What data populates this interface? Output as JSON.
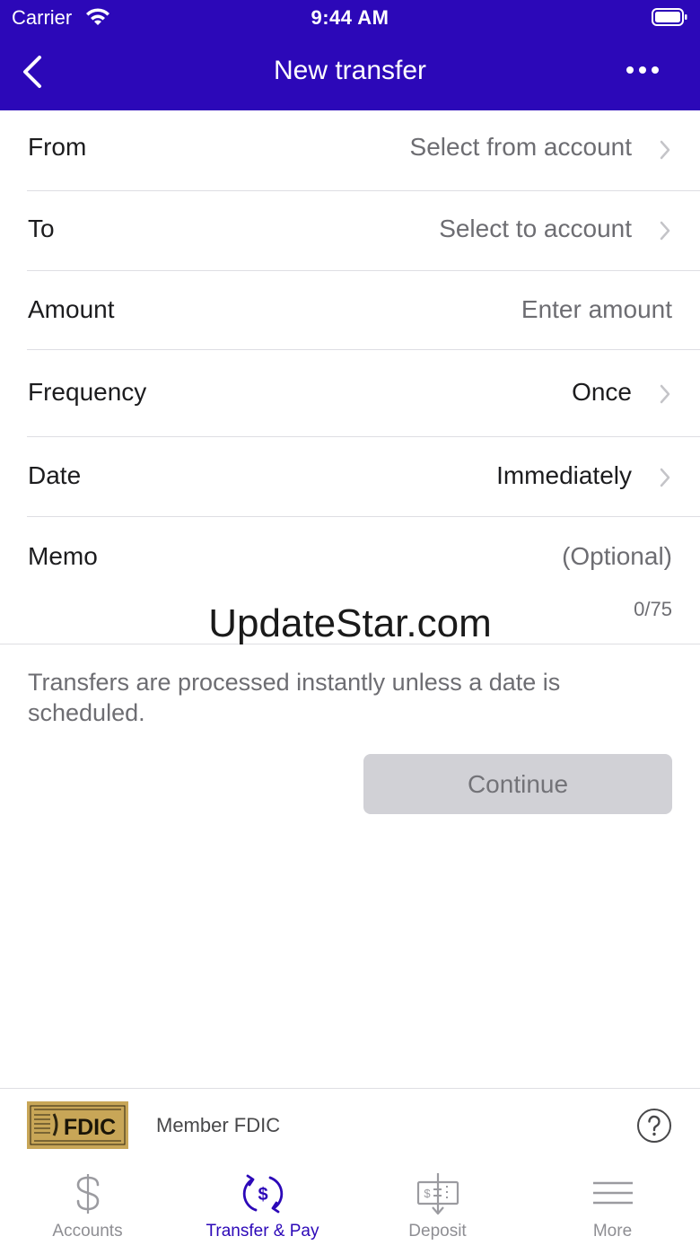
{
  "status_bar": {
    "carrier": "Carrier",
    "time": "9:44 AM"
  },
  "nav": {
    "title": "New transfer"
  },
  "form": {
    "from": {
      "label": "From",
      "placeholder": "Select from account"
    },
    "to": {
      "label": "To",
      "placeholder": "Select to account"
    },
    "amount": {
      "label": "Amount",
      "placeholder": "Enter amount"
    },
    "frequency": {
      "label": "Frequency",
      "value": "Once"
    },
    "date": {
      "label": "Date",
      "value": "Immediately"
    },
    "memo": {
      "label": "Memo",
      "placeholder": "(Optional)",
      "counter": "0/75"
    }
  },
  "watermark": "UpdateStar.com",
  "info_text": "Transfers are processed instantly unless a date is scheduled.",
  "continue_label": "Continue",
  "fdic": {
    "logo_text": "FDIC",
    "member_text": "Member FDIC"
  },
  "tabs": [
    {
      "label": "Accounts",
      "icon": "dollar-icon"
    },
    {
      "label": "Transfer & Pay",
      "icon": "transfer-pay-icon",
      "active": true
    },
    {
      "label": "Deposit",
      "icon": "deposit-check-icon"
    },
    {
      "label": "More",
      "icon": "menu-icon"
    }
  ],
  "colors": {
    "brand": "#2c08b8",
    "disabled_button": "#d1d1d6",
    "fdic_gold": "#c8a657"
  }
}
